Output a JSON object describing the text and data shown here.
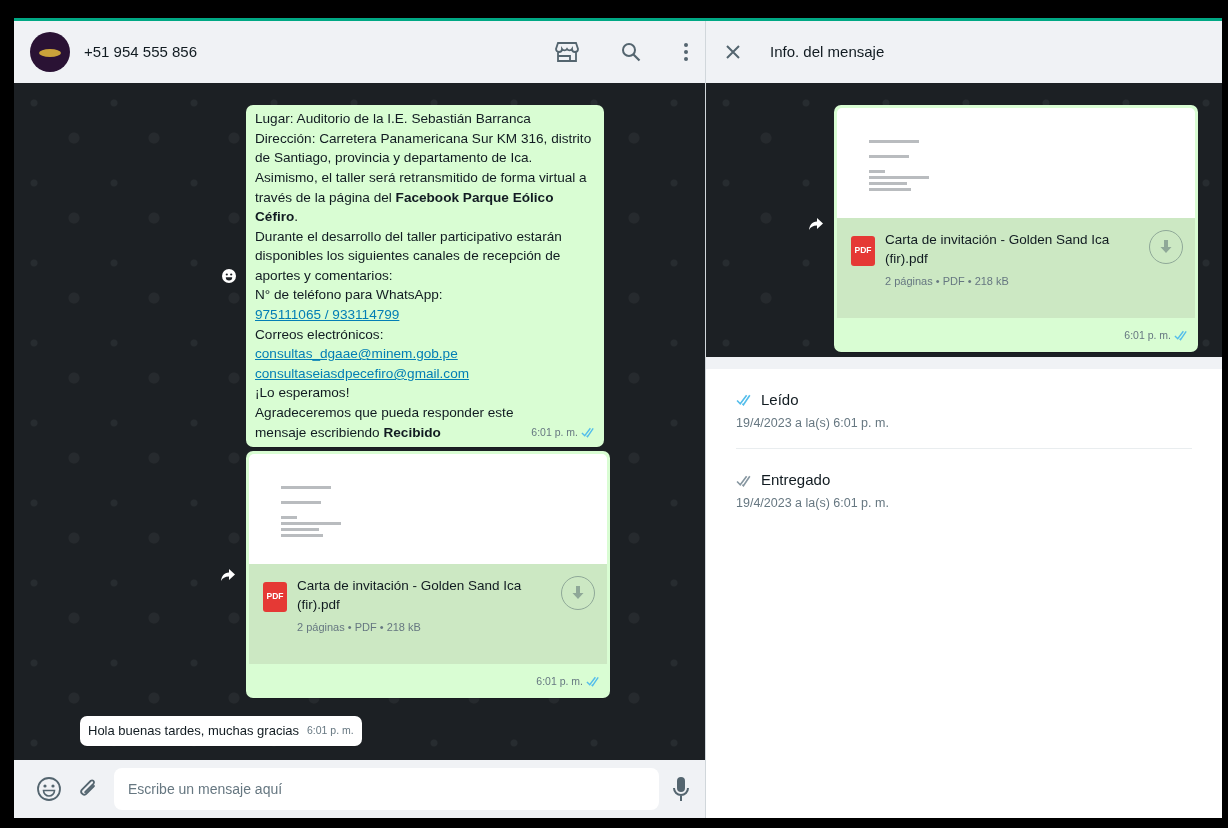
{
  "chat": {
    "contact": "+51 954 555 856",
    "messages": [
      {
        "kind": "text",
        "outgoing": true,
        "reaction_button": true,
        "forward_button": false,
        "read": true,
        "time": "6:01 p. m.",
        "lines": [
          {
            "kind": "text",
            "text": "Lugar: Auditorio de la I.E. Sebastián Barranca"
          },
          {
            "kind": "text",
            "text": "Dirección: Carretera Panamericana Sur KM 316, distrito de Santiago, provincia y departamento de Ica."
          },
          {
            "kind": "text",
            "text": "Asimismo, el taller será retransmitido de forma virtual a través de la página del **Facebook Parque Eólico Céfiro**."
          },
          {
            "kind": "text",
            "text": "Durante el desarrollo del taller participativo estarán disponibles los siguientes canales de recepción de aportes y comentarios:"
          },
          {
            "kind": "text",
            "text": "N° de teléfono para WhatsApp:"
          },
          {
            "kind": "link",
            "text": "975111065 / 933114799"
          },
          {
            "kind": "text",
            "text": "Correos electrónicos:"
          },
          {
            "kind": "link",
            "text": "consultas_dgaae@minem.gob.pe"
          },
          {
            "kind": "link",
            "text": "consultaseiasdpecefiro@gmail.com"
          },
          {
            "kind": "text",
            "text": "¡Lo esperamos!"
          },
          {
            "kind": "text",
            "text": "Agradeceremos que pueda responder este mensaje escribiendo **Recibido**"
          }
        ]
      },
      {
        "kind": "document",
        "outgoing": true,
        "reaction_button": false,
        "forward_button": true,
        "read": true,
        "time": "6:01 p. m.",
        "file_badge": "PDF",
        "file_name": "Carta de invitación - Golden Sand Ica (fir).pdf",
        "file_meta": "2 páginas • PDF • 218 kB"
      },
      {
        "kind": "text",
        "outgoing": false,
        "reaction_button": false,
        "forward_button": false,
        "time": "6:01 p. m.",
        "lines": [
          {
            "kind": "text",
            "text": "Hola buenas tardes, muchas gracias"
          }
        ]
      }
    ],
    "composer": {
      "placeholder": "Escribe un mensaje aquí"
    }
  },
  "info": {
    "title": "Info. del mensaje",
    "message": {
      "kind": "document",
      "outgoing": true,
      "reaction_button": false,
      "forward_button": true,
      "read": true,
      "time": "6:01 p. m.",
      "file_badge": "PDF",
      "file_name": "Carta de invitación - Golden Sand Ica (fir).pdf",
      "file_meta": "2 páginas • PDF • 218 kB"
    },
    "receipts": [
      {
        "label": "Leído",
        "time": "19/4/2023 a la(s) 6:01 p. m.",
        "read": true
      },
      {
        "label": "Entregado",
        "time": "19/4/2023 a la(s) 6:01 p. m.",
        "read": false
      }
    ]
  }
}
